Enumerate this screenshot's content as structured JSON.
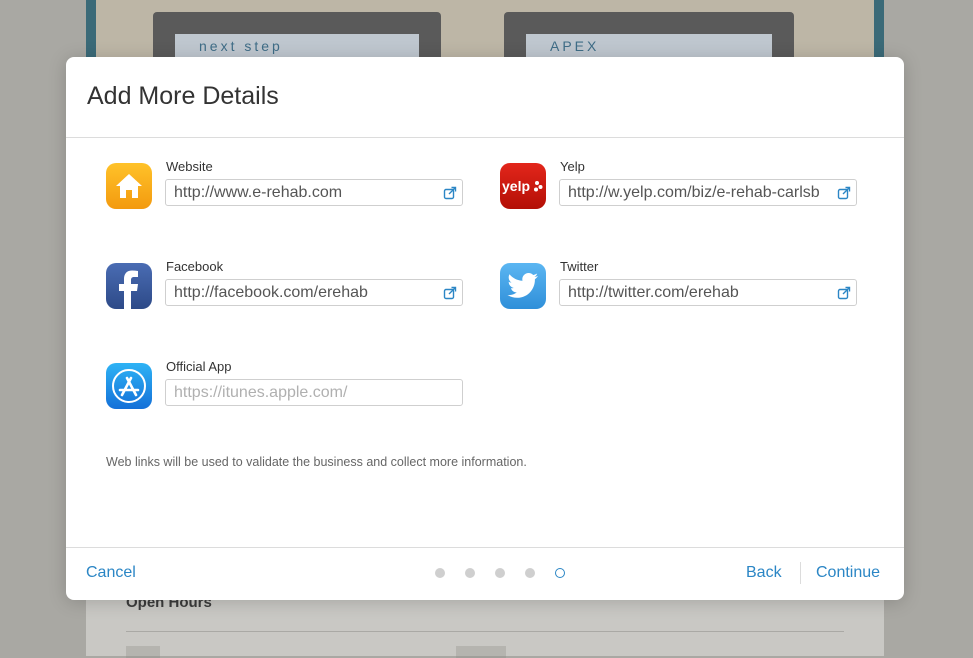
{
  "background": {
    "brand_left": "next step",
    "brand_right": "APEX",
    "section_title": "Open Hours"
  },
  "modal": {
    "title": "Add More Details",
    "fields": {
      "website": {
        "label": "Website",
        "value": "http://www.e-rehab.com",
        "icon": "home-icon"
      },
      "yelp": {
        "label": "Yelp",
        "value": "http://w.yelp.com/biz/e-rehab-carlsb",
        "icon": "yelp-icon"
      },
      "facebook": {
        "label": "Facebook",
        "value": "http://facebook.com/erehab",
        "icon": "facebook-icon"
      },
      "twitter": {
        "label": "Twitter",
        "value": "http://twitter.com/erehab",
        "icon": "twitter-icon"
      },
      "official_app": {
        "label": "Official App",
        "value": "",
        "placeholder": "https://itunes.apple.com/",
        "icon": "app-store-icon"
      }
    },
    "note": "Web links will be used to validate the business and collect more information.",
    "footer": {
      "cancel": "Cancel",
      "back": "Back",
      "continue": "Continue",
      "steps_total": 5,
      "current_step": 5
    }
  },
  "colors": {
    "accent": "#2b86c5",
    "website_icon": "#f7a51d",
    "yelp_icon": "#c41200",
    "facebook_icon": "#3b5998",
    "twitter_icon": "#3a9ee8",
    "app_store_icon": "#1a8de6"
  }
}
